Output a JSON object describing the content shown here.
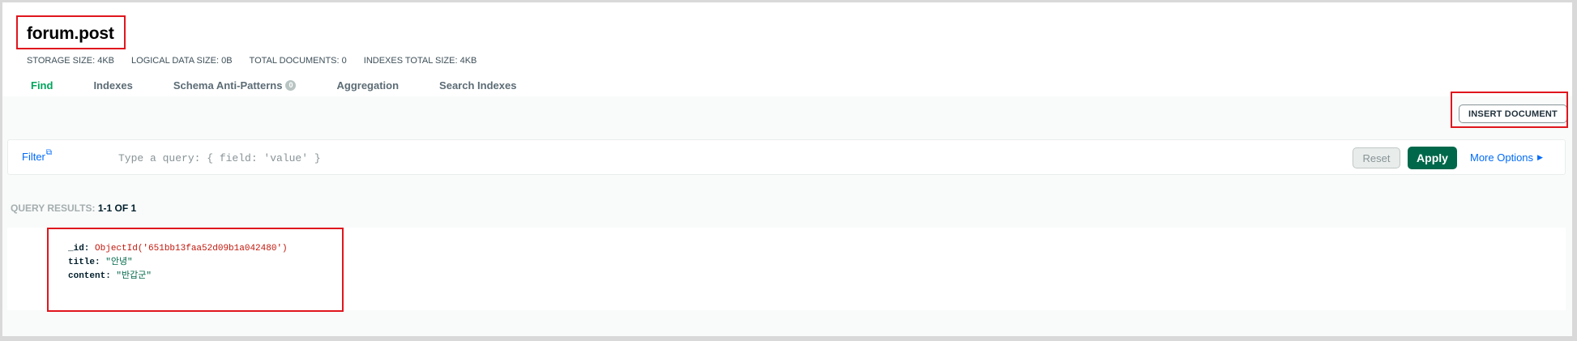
{
  "collection": {
    "title": "forum.post"
  },
  "stats": [
    {
      "label": "STORAGE SIZE:",
      "value": "4KB"
    },
    {
      "label": "LOGICAL DATA SIZE:",
      "value": "0B"
    },
    {
      "label": "TOTAL DOCUMENTS:",
      "value": "0"
    },
    {
      "label": "INDEXES TOTAL SIZE:",
      "value": "4KB"
    }
  ],
  "tabs": [
    {
      "label": "Find",
      "active": true
    },
    {
      "label": "Indexes"
    },
    {
      "label": "Schema Anti-Patterns",
      "count": "0"
    },
    {
      "label": "Aggregation"
    },
    {
      "label": "Search Indexes"
    }
  ],
  "toolbar": {
    "insert_label": "INSERT DOCUMENT"
  },
  "filter": {
    "label": "Filter",
    "placeholder": "Type a query: { field: 'value' }",
    "reset_label": "Reset",
    "apply_label": "Apply",
    "more_options_label": "More Options"
  },
  "results": {
    "label": "QUERY RESULTS:",
    "range": "1-1 OF 1"
  },
  "document": {
    "id_key": "_id:",
    "id_value": "ObjectId('651bb13faa52d09b1a042480')",
    "title_key": "title:",
    "title_value": "\"안녕\"",
    "content_key": "content:",
    "content_value": "\"반갑군\""
  },
  "colors": {
    "accent": "#00a35c",
    "apply_bg": "#00684a",
    "link": "#016bf8",
    "object_id": "#c1160b",
    "highlight": "#e0161d"
  }
}
